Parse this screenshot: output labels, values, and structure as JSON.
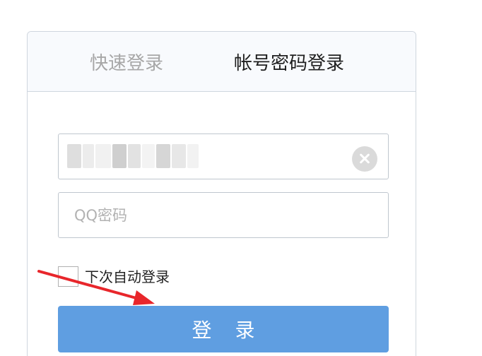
{
  "tabs": {
    "quick_login_label": "快速登录",
    "account_password_login_label": "帐号密码登录"
  },
  "form": {
    "password_placeholder": "QQ密码",
    "auto_login_label": "下次自动登录",
    "login_button_label": "登 录"
  },
  "colors": {
    "login_button": "#5f9ee1",
    "annotation_arrow": "#e8262b",
    "active_tab_text": "#1f1f1f",
    "inactive_tab_text": "#a7a7a7"
  },
  "icons": {
    "clear_input": "close-circle-icon",
    "annotation": "arrow-icon"
  }
}
